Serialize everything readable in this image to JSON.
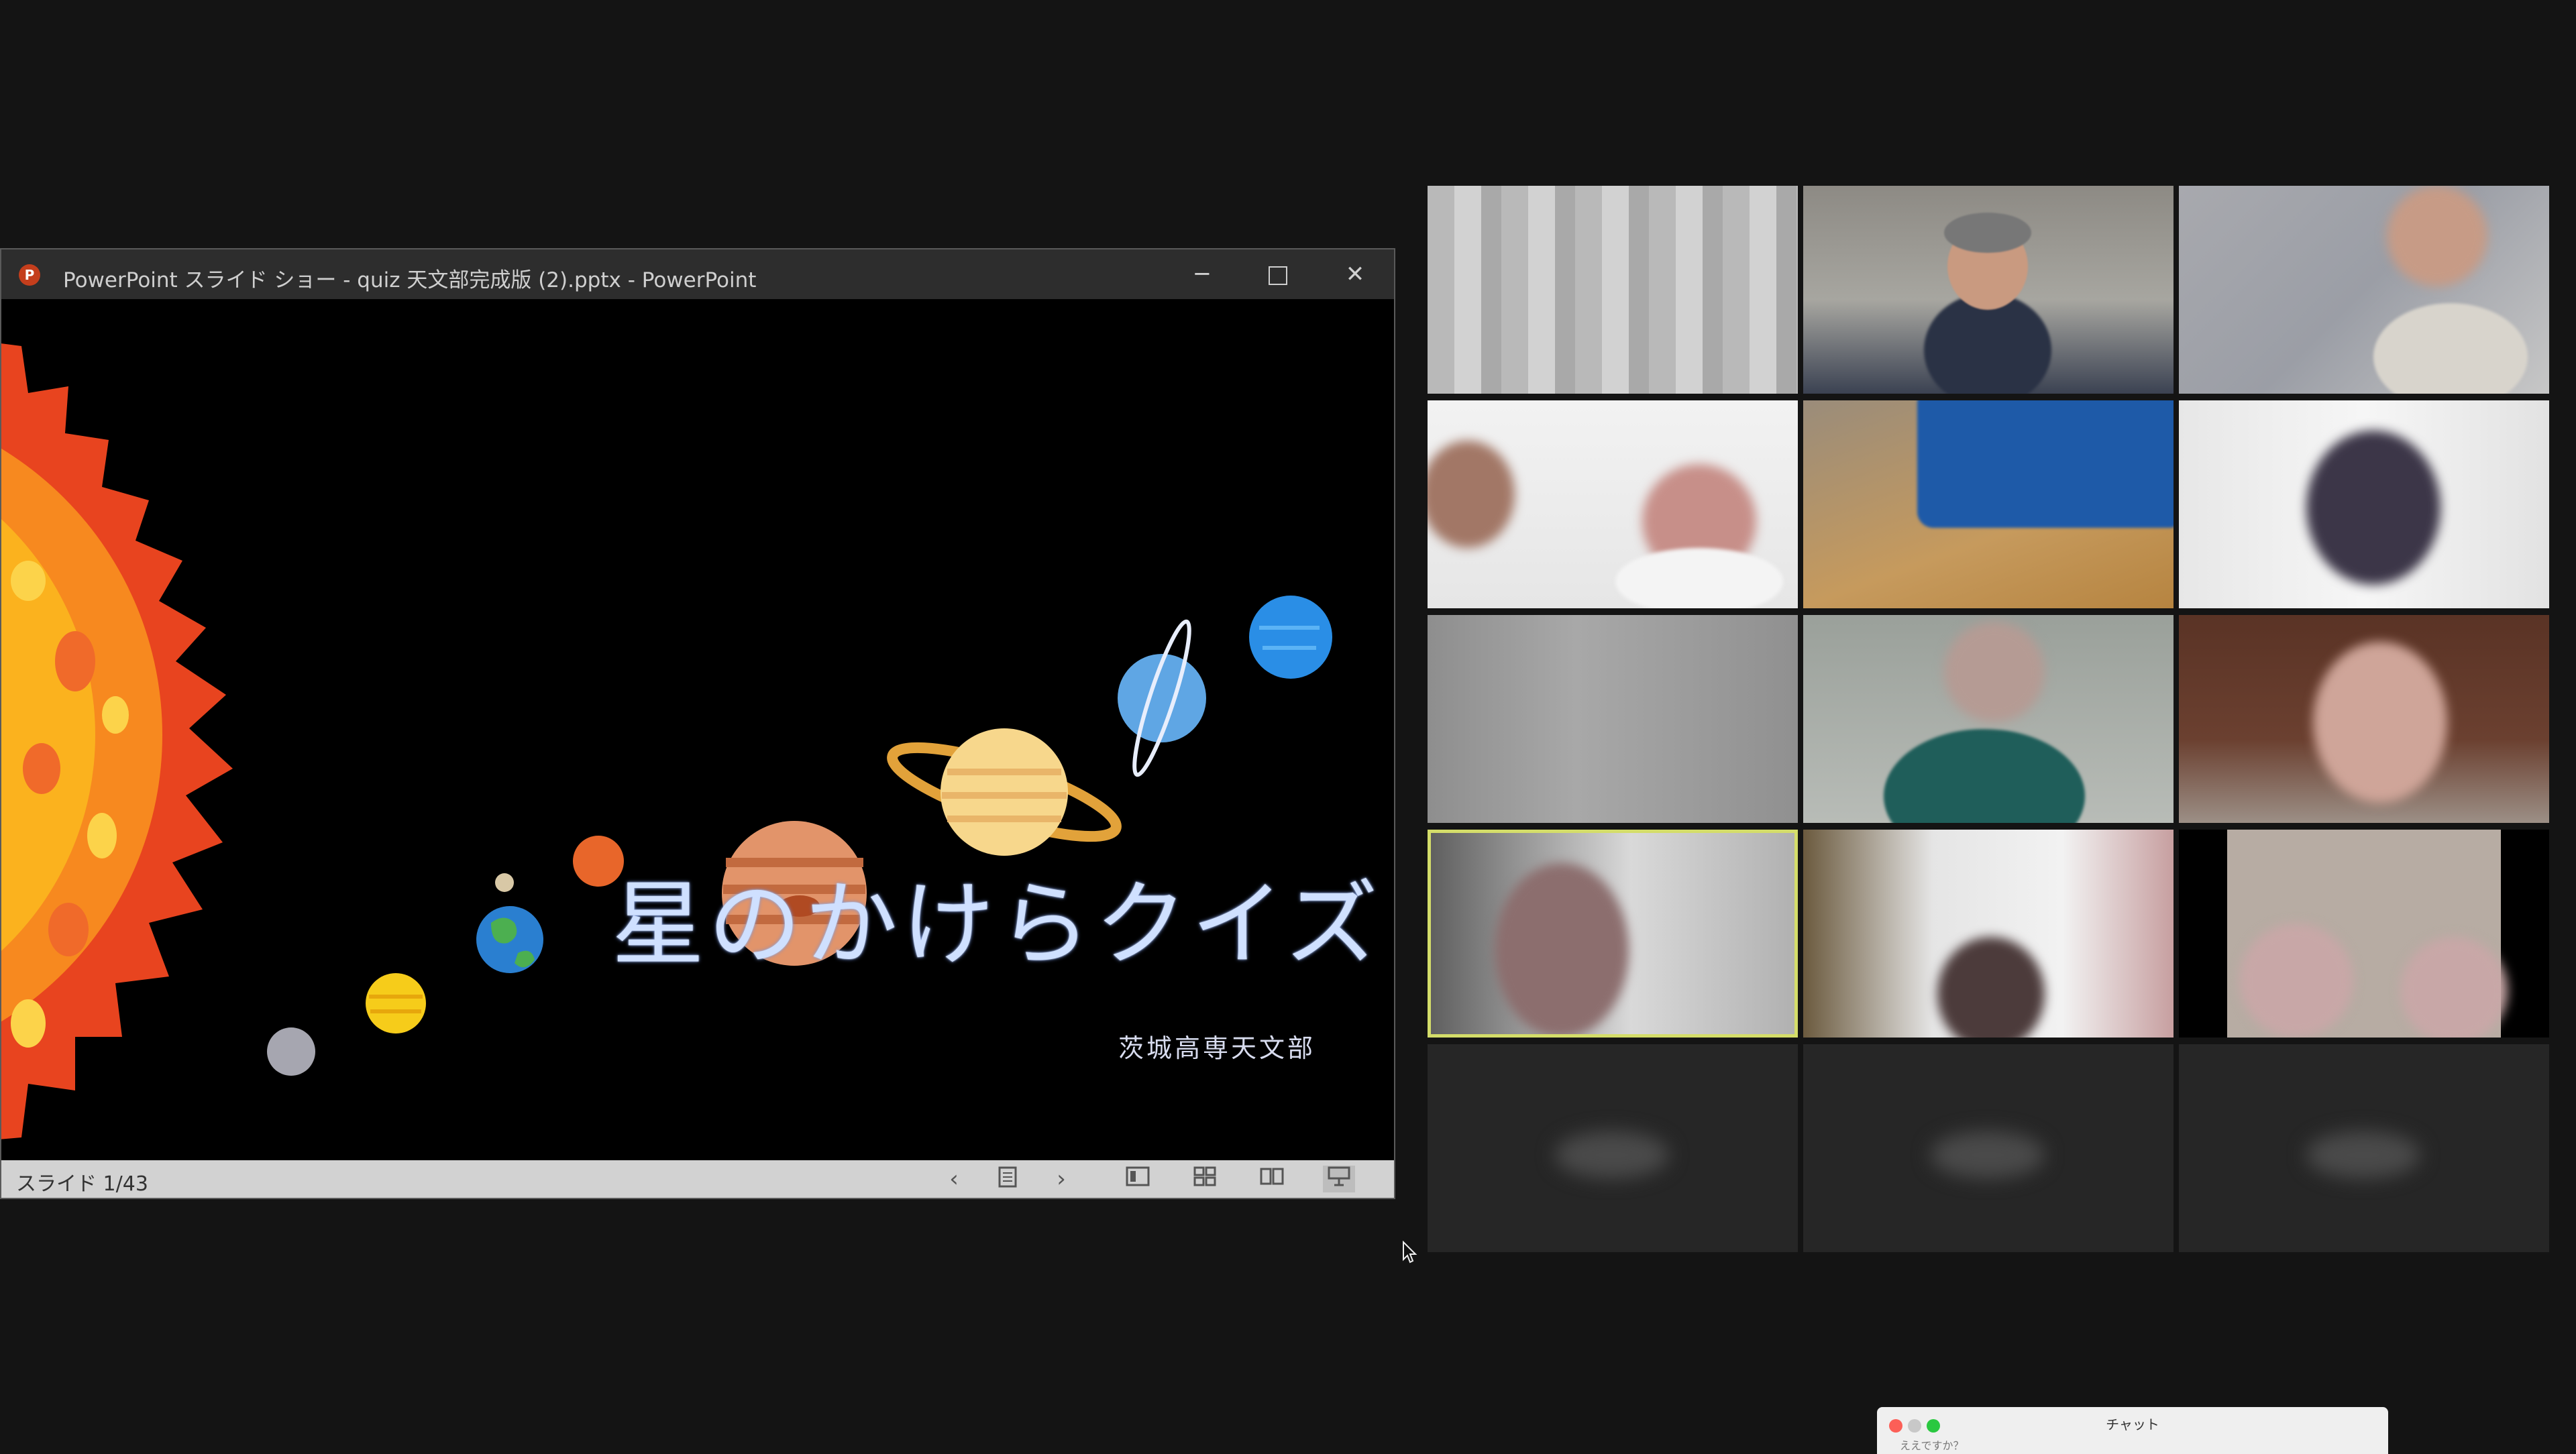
{
  "ppt_window": {
    "title": "PowerPoint スライド ショー  -  quiz 天文部完成版 (2).pptx - PowerPoint",
    "app_icon": "P",
    "controls": {
      "minimize": "─",
      "close": "✕"
    }
  },
  "slide": {
    "title": "星のかけらクイズ",
    "subtitle": "茨城高専天文部"
  },
  "statusbar": {
    "slide_counter": "スライド 1/43",
    "prev": "‹",
    "next": "›"
  },
  "gallery": {
    "tile_count": 15,
    "active_speaker_tile": 10
  },
  "chat": {
    "title": "チャット",
    "preview": "ええですか？"
  },
  "colors": {
    "active_speaker_border": "#d4dd6a",
    "ppt_icon": "#c43e1c",
    "background": "#141414"
  }
}
